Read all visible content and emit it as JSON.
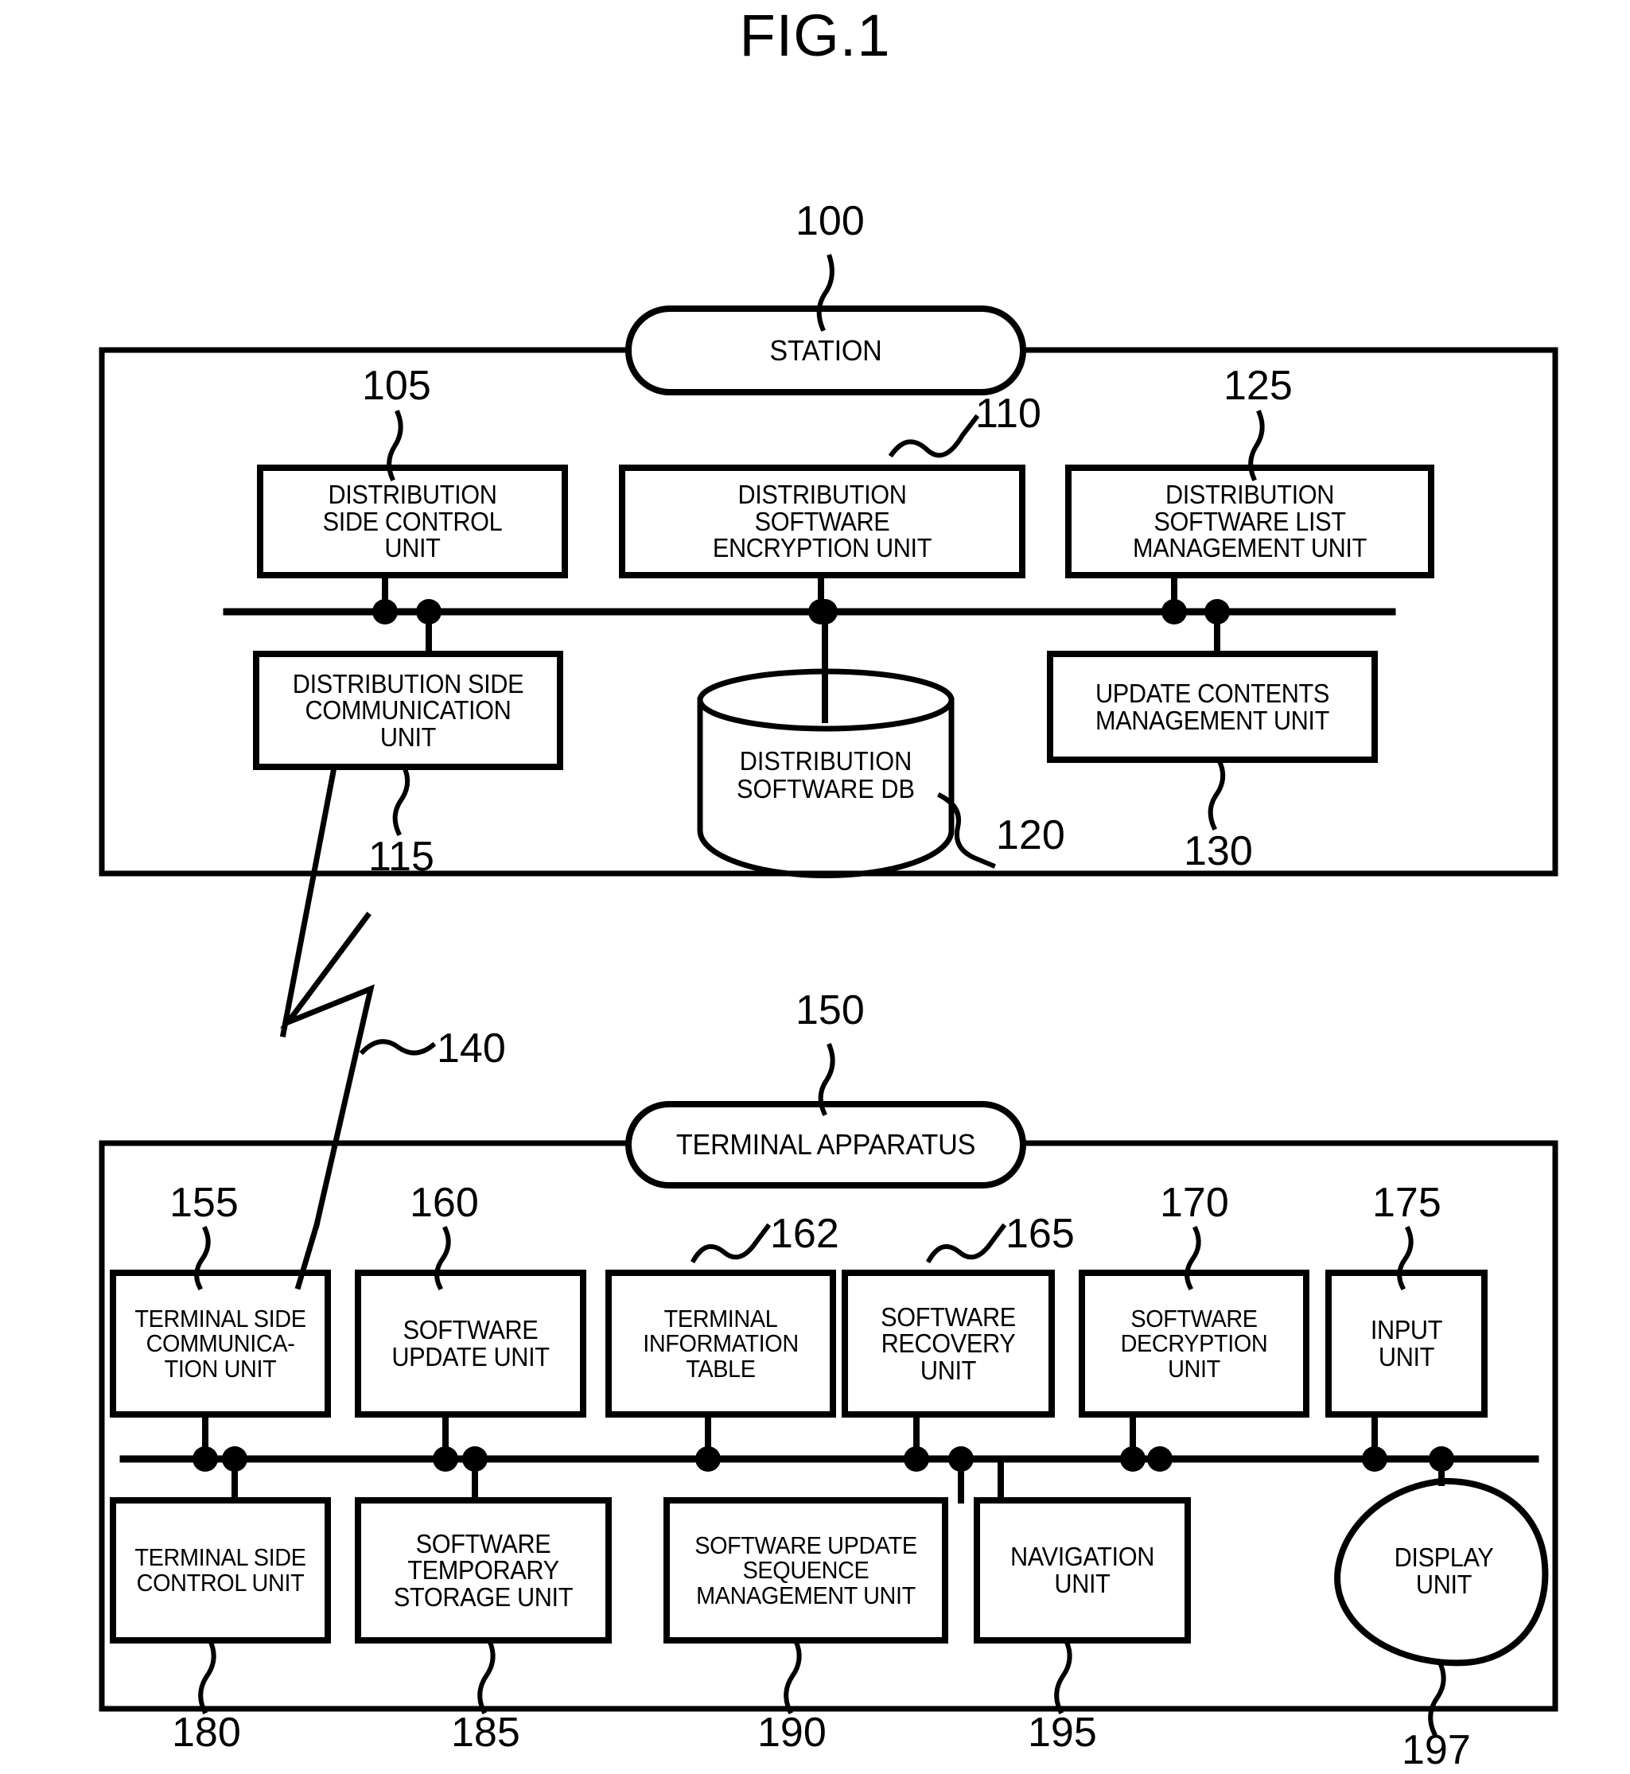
{
  "figure": {
    "title": "FIG.1",
    "type": "patent-block-diagram"
  },
  "station_panel": {
    "header_label": "STATION",
    "header_ref": "100",
    "top_row": [
      {
        "ref": "105",
        "label": "DISTRIBUTION\nSIDE CONTROL\nUNIT"
      },
      {
        "ref": "110",
        "label": "DISTRIBUTION\nSOFTWARE\nENCRYPTION UNIT"
      },
      {
        "ref": "125",
        "label": "DISTRIBUTION\nSOFTWARE LIST\nMANAGEMENT UNIT"
      }
    ],
    "bottom_row": [
      {
        "ref": "115",
        "label": "DISTRIBUTION SIDE\nCOMMUNICATION\nUNIT",
        "shape": "box"
      },
      {
        "ref": "120",
        "label": "DISTRIBUTION\nSOFTWARE DB",
        "shape": "cylinder"
      },
      {
        "ref": "130",
        "label": "UPDATE CONTENTS\nMANAGEMENT UNIT",
        "shape": "box"
      }
    ]
  },
  "link": {
    "ref": "140",
    "symbol": "lightning-bolt-wireless-link"
  },
  "terminal_panel": {
    "header_label": "TERMINAL APPARATUS",
    "header_ref": "150",
    "top_row": [
      {
        "ref": "155",
        "label": "TERMINAL SIDE\nCOMMUNICA-\nTION UNIT"
      },
      {
        "ref": "160",
        "label": "SOFTWARE\nUPDATE UNIT"
      },
      {
        "ref": "162",
        "label": "TERMINAL\nINFORMATION\nTABLE"
      },
      {
        "ref": "165",
        "label": "SOFTWARE\nRECOVERY\nUNIT"
      },
      {
        "ref": "170",
        "label": "SOFTWARE\nDECRYPTION\nUNIT"
      },
      {
        "ref": "175",
        "label": "INPUT\nUNIT"
      }
    ],
    "bottom_row": [
      {
        "ref": "180",
        "label": "TERMINAL SIDE\nCONTROL UNIT",
        "shape": "box"
      },
      {
        "ref": "185",
        "label": "SOFTWARE\nTEMPORARY\nSTORAGE UNIT",
        "shape": "box"
      },
      {
        "ref": "190",
        "label": "SOFTWARE UPDATE\nSEQUENCE\nMANAGEMENT UNIT",
        "shape": "box"
      },
      {
        "ref": "195",
        "label": "NAVIGATION\nUNIT",
        "shape": "box"
      },
      {
        "ref": "197",
        "label": "DISPLAY\nUNIT",
        "shape": "blob"
      }
    ]
  },
  "colors": {
    "ink": "#000000",
    "paper": "#ffffff"
  }
}
